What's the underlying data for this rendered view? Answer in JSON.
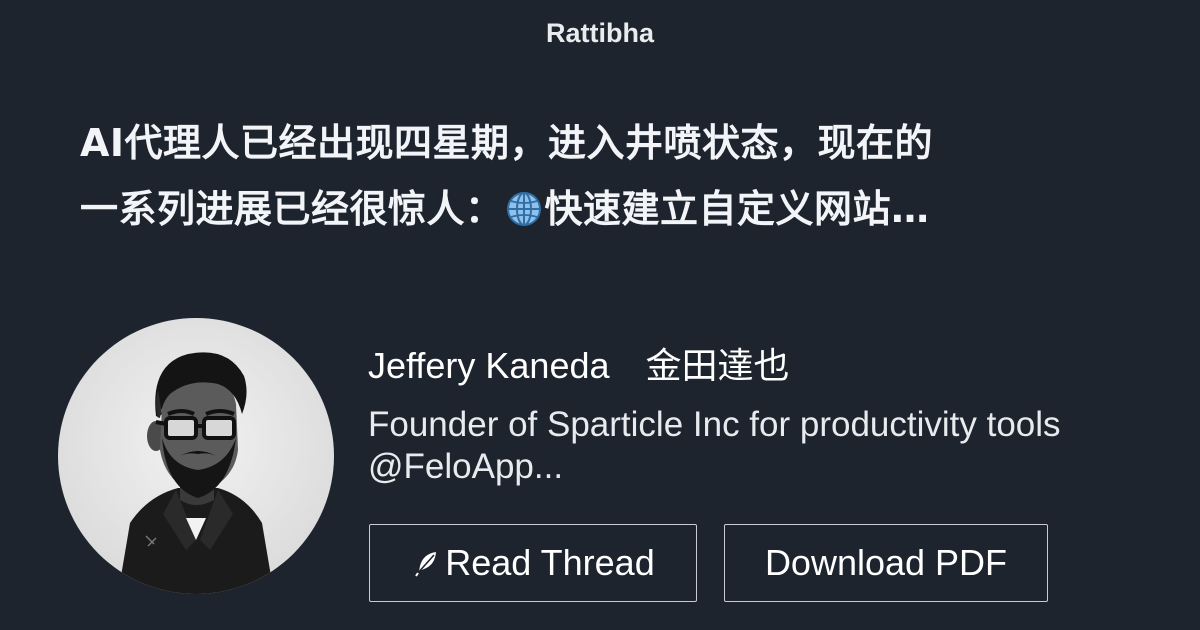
{
  "site": {
    "name": "Rattibha"
  },
  "thread": {
    "title_line1": "AI代理人已经出现四星期，进入井喷状态，现在的",
    "title_line2_before_icon": "一系列进展已经很惊人：",
    "title_line2_icon": "globe-icon",
    "title_line2_after_icon": "快速建立自定义网站…"
  },
  "author": {
    "name": "Jeffery Kaneda　金田達也",
    "bio_line1": "Founder of Sparticle Inc for productivity tools",
    "bio_line2": "@FeloApp...",
    "avatar_icon": "bearded-man-with-glasses-avatar"
  },
  "actions": {
    "read_thread_label": "Read Thread",
    "read_thread_icon": "feather-icon",
    "download_pdf_label": "Download PDF"
  },
  "colors": {
    "background": "#1d242e",
    "text": "#ffffff",
    "button_border": "#c8ccd2"
  }
}
